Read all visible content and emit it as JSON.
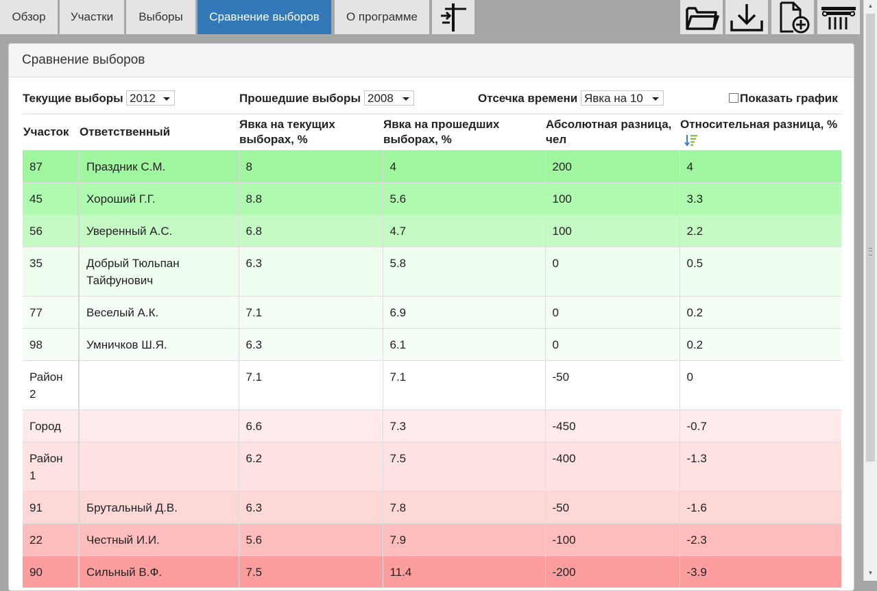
{
  "tabs": [
    {
      "label": "Обзор",
      "active": false
    },
    {
      "label": "Участки",
      "active": false
    },
    {
      "label": "Выборы",
      "active": false
    },
    {
      "label": "Сравнение выборов",
      "active": true
    },
    {
      "label": "О программе",
      "active": false
    }
  ],
  "toolbar": {
    "split_icon": "signpost-icon",
    "open_icon": "folder-open-icon",
    "download_icon": "download-icon",
    "new_icon": "new-document-icon",
    "column_icon": "column-icon"
  },
  "panel": {
    "title": "Сравнение выборов"
  },
  "controls": {
    "current_label": "Текущие выборы",
    "current_value": "2012",
    "past_label": "Прошедшие выборы",
    "past_value": "2008",
    "cutoff_label": "Отсечка времени",
    "cutoff_value": "Явка на 10",
    "show_chart_label": "Показать график",
    "show_chart_checked": false
  },
  "table": {
    "headers": [
      "Участок",
      "Ответственный",
      "Явка на текущих выборах, %",
      "Явка на прошедших выборах, %",
      "Абсолютная разница, чел",
      "Относительная разница, %"
    ],
    "sorted_column": 5,
    "sort_direction": "descending",
    "rows": [
      {
        "cells": [
          "87",
          "Праздник С.М.",
          "8",
          "4",
          "200",
          "4"
        ],
        "color": "#9ff69f"
      },
      {
        "cells": [
          "45",
          "Хороший Г.Г.",
          "8.8",
          "5.6",
          "100",
          "3.3"
        ],
        "color": "#b0f9b0"
      },
      {
        "cells": [
          "56",
          "Уверенный А.С.",
          "6.8",
          "4.7",
          "100",
          "2.2"
        ],
        "color": "#c5fac5"
      },
      {
        "cells": [
          "35",
          "Добрый Тюльпан Тайфунович",
          "6.3",
          "5.8",
          "0",
          "0.5"
        ],
        "color": "#effdef"
      },
      {
        "cells": [
          "77",
          "Веселый А.К.",
          "7.1",
          "6.9",
          "0",
          "0.2"
        ],
        "color": "#f5fef5"
      },
      {
        "cells": [
          "98",
          "Умничков Ш.Я.",
          "6.3",
          "6.1",
          "0",
          "0.2"
        ],
        "color": "#f5fef5"
      },
      {
        "cells": [
          "Район 2",
          "",
          "7.1",
          "7.1",
          "-50",
          "0"
        ],
        "color": "#ffffff"
      },
      {
        "cells": [
          "Город",
          "",
          "6.6",
          "7.3",
          "-450",
          "-0.7"
        ],
        "color": "#feeaea"
      },
      {
        "cells": [
          "Район 1",
          "",
          "6.2",
          "7.5",
          "-400",
          "-1.3"
        ],
        "color": "#fee1e1"
      },
      {
        "cells": [
          "91",
          "Брутальный Д.В.",
          "6.3",
          "7.8",
          "-50",
          "-1.6"
        ],
        "color": "#fed7d7"
      },
      {
        "cells": [
          "22",
          "Честный И.И.",
          "5.6",
          "7.9",
          "-100",
          "-2.3"
        ],
        "color": "#febdbd"
      },
      {
        "cells": [
          "90",
          "Сильный В.Ф.",
          "7.5",
          "11.4",
          "-200",
          "-3.9"
        ],
        "color": "#fe9d9d"
      }
    ]
  }
}
